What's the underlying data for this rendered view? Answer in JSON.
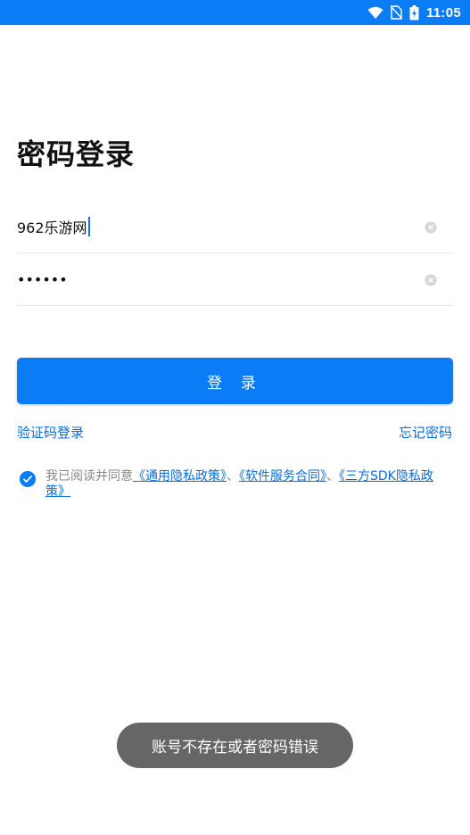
{
  "status_bar": {
    "time": "11:05",
    "icons": [
      "wifi-icon",
      "no-sim-icon",
      "battery-charging-icon"
    ]
  },
  "page": {
    "title": "密码登录"
  },
  "form": {
    "account_value": "962乐游网",
    "password_value": "••••••",
    "login_button_label": "登 录"
  },
  "links": {
    "sms_login": "验证码登录",
    "forgot_password": "忘记密码"
  },
  "agreement": {
    "checked": true,
    "prefix": "我已阅读并同意",
    "policy_general": "《通用隐私政策》",
    "separator_1": "、",
    "service_contract": "《软件服务合同》",
    "separator_2": "、",
    "third_party_sdk": "《三方SDK隐私政策》"
  },
  "toast": {
    "message": "账号不存在或者密码错误"
  },
  "colors": {
    "primary": "#0a7cf5",
    "link": "#0a6fe0",
    "toast_bg": "#666666"
  }
}
